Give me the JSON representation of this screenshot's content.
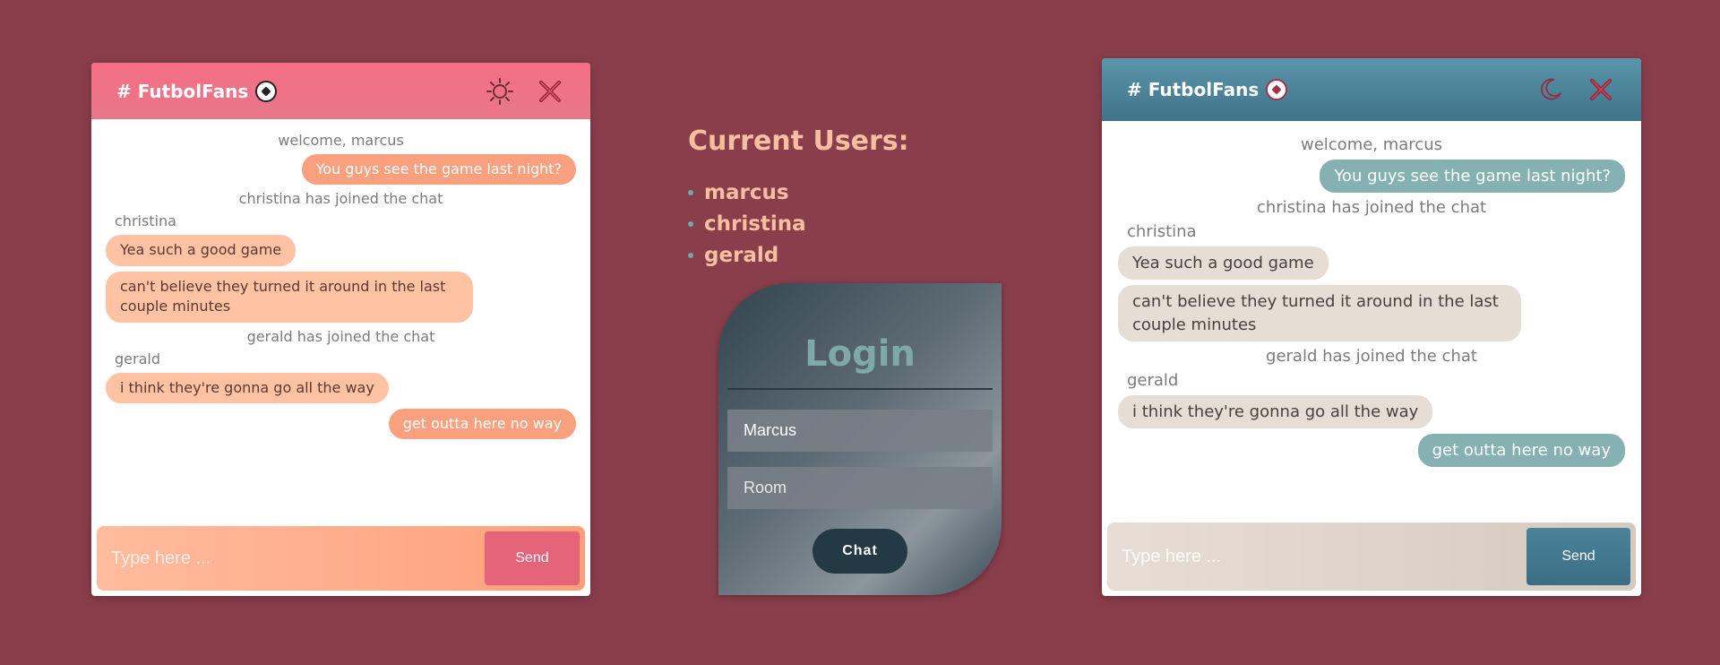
{
  "left_panel": {
    "room_title": "# FutbolFans",
    "theme_icon": "sun-icon",
    "close_icon": "close-icon",
    "messages": [
      {
        "type": "system",
        "text": "welcome, marcus"
      },
      {
        "type": "out",
        "text": "You guys see the game last night?"
      },
      {
        "type": "system",
        "text": "christina has joined the chat"
      },
      {
        "type": "name",
        "text": "christina"
      },
      {
        "type": "in",
        "text": "Yea such a good game"
      },
      {
        "type": "in",
        "text": "can't believe they turned it around in the last couple minutes"
      },
      {
        "type": "system",
        "text": "gerald has joined the chat"
      },
      {
        "type": "name",
        "text": "gerald"
      },
      {
        "type": "in",
        "text": "i think they're gonna go all the way"
      },
      {
        "type": "out",
        "text": "get outta here no way"
      }
    ],
    "composer_placeholder": "Type here ...",
    "send_label": "Send"
  },
  "users_panel": {
    "title": "Current Users:",
    "users": [
      "marcus",
      "christina",
      "gerald"
    ]
  },
  "login": {
    "title": "Login",
    "name_value": "Marcus",
    "room_placeholder": "Room",
    "submit_label": "Chat"
  },
  "right_panel": {
    "room_title": "# FutbolFans",
    "theme_icon": "moon-icon",
    "close_icon": "close-icon",
    "messages": [
      {
        "type": "system",
        "text": "welcome, marcus"
      },
      {
        "type": "out",
        "text": "You guys see the game last night?"
      },
      {
        "type": "system",
        "text": "christina has joined the chat"
      },
      {
        "type": "name",
        "text": "christina"
      },
      {
        "type": "in",
        "text": "Yea such a good game"
      },
      {
        "type": "in",
        "text": "can't believe they turned it around in the last couple minutes"
      },
      {
        "type": "system",
        "text": "gerald has joined the chat"
      },
      {
        "type": "name",
        "text": "gerald"
      },
      {
        "type": "in",
        "text": "i think they're gonna go all the way"
      },
      {
        "type": "out",
        "text": "get outta here no way"
      }
    ],
    "composer_placeholder": "Type here ...",
    "send_label": "Send"
  },
  "colors": {
    "background": "#8a3e4c",
    "light_header": "#f56e84",
    "dark_header": "#4a8499",
    "accent_close": "#c0283c"
  }
}
